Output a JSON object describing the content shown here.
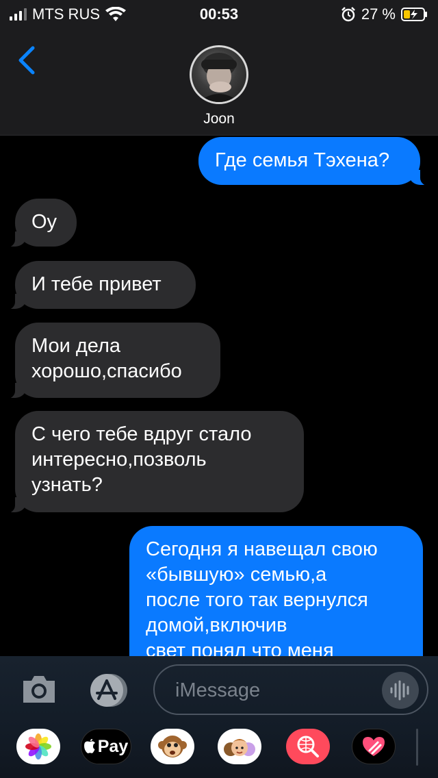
{
  "status_bar": {
    "carrier": "MTS RUS",
    "time": "00:53",
    "battery_percent": "27 %"
  },
  "header": {
    "contact_name": "Joon"
  },
  "messages": [
    {
      "direction": "outgoing",
      "lines": [
        "Где семья Тэхена?"
      ]
    },
    {
      "direction": "incoming",
      "lines": [
        "Оу"
      ]
    },
    {
      "direction": "incoming",
      "lines": [
        "И тебе привет"
      ]
    },
    {
      "direction": "incoming",
      "lines": [
        "Мои дела",
        "хорошо,спасибо"
      ]
    },
    {
      "direction": "incoming",
      "lines": [
        "С чего тебе вдруг стало",
        "интересно,позволь",
        "узнать?"
      ]
    },
    {
      "direction": "outgoing",
      "lines": [
        "Сегодня я навещал свою",
        "«бывшую» семью,а",
        "после того так вернулся",
        "домой,включив",
        "свет понял что меня"
      ]
    }
  ],
  "composer": {
    "placeholder": "iMessage"
  },
  "app_drawer": {
    "items": [
      {
        "name": "photos",
        "icon": "photos-icon"
      },
      {
        "name": "apple-pay",
        "label": "Pay",
        "icon": "apple-logo-icon"
      },
      {
        "name": "animoji",
        "icon": "monkey-emoji-icon"
      },
      {
        "name": "memoji",
        "icon": "memoji-icon"
      },
      {
        "name": "images-search",
        "icon": "globe-search-icon"
      },
      {
        "name": "digital-touch",
        "icon": "heart-touch-icon"
      }
    ]
  },
  "colors": {
    "outgoing_bubble": "#0a7aff",
    "incoming_bubble": "#2c2c2e",
    "accent": "#0a84ff"
  }
}
